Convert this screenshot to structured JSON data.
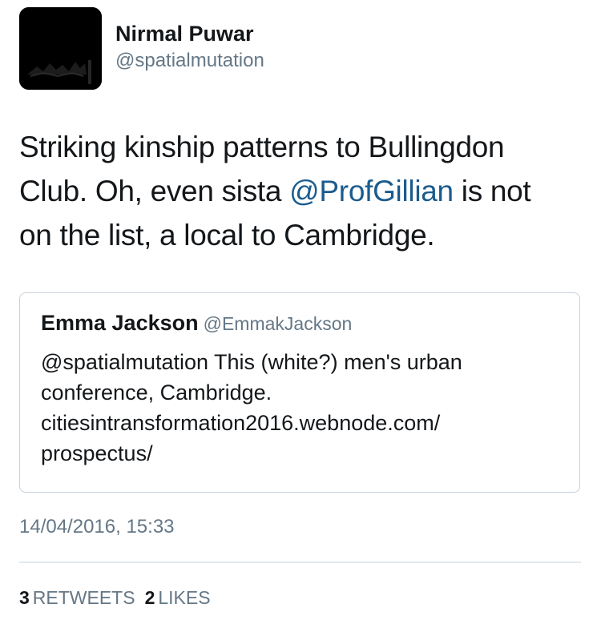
{
  "author": {
    "display_name": "Nirmal Puwar",
    "handle": "@spatialmutation"
  },
  "tweet": {
    "line1": "Striking kinship patterns to Bullingdon",
    "line2_before": "Club. Oh, even sista ",
    "mention": "@ProfGillian",
    "line2_after": " is not",
    "line3": "on the list, a local to Cambridge."
  },
  "quoted_tweet": {
    "display_name": "Emma Jackson",
    "handle": "@EmmakJackson",
    "lines": [
      "@spatialmutation This (white?) men's urban",
      "conference, Cambridge.",
      "citiesintransformation2016.webnode.com/",
      "prospectus/"
    ]
  },
  "timestamp": "14/04/2016, 15:33",
  "stats": {
    "retweets_count": "3",
    "retweets_label": "RETWEETS",
    "likes_count": "2",
    "likes_label": "LIKES"
  },
  "colors": {
    "mention": "#1b5c8e",
    "secondary_text": "#657786",
    "border": "#c9d1d8"
  }
}
